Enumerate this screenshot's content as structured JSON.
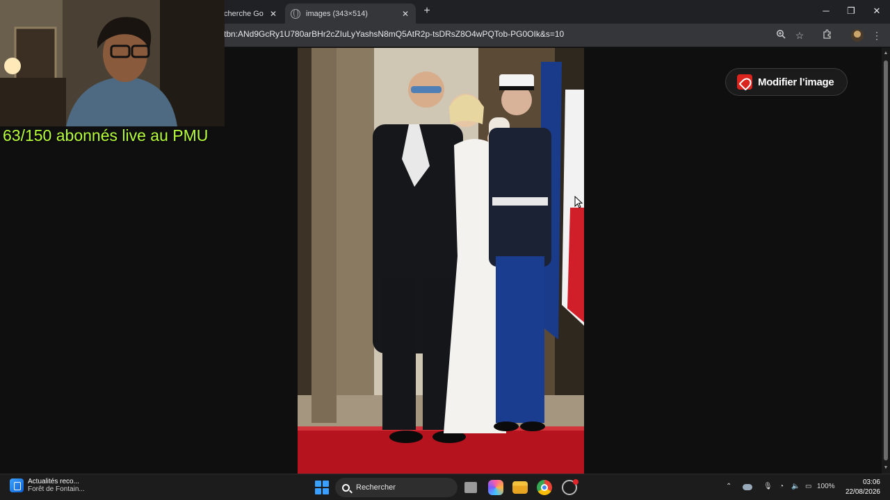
{
  "browser": {
    "tabs": [
      {
        "label": "Recherche Go",
        "active": false
      },
      {
        "label": "images (343×514)",
        "active": true
      }
    ],
    "url": "tbn:ANd9GcRy1U780arBHr2cZIuLyYashsN8mQ5AtR2p-tsDRsZ8O4wPQTob-PG0OIk&s=10",
    "window_controls": {
      "minimize": "─",
      "restore": "❐",
      "close": "✕"
    }
  },
  "viewer": {
    "modify_button_label": "Modifier l’image"
  },
  "overlay": {
    "text": "63/150 abonnés live au PMU"
  },
  "taskbar": {
    "news_title": "Actualités reco...",
    "news_subtitle": "Forêt de Fontain...",
    "search_placeholder": "Rechercher",
    "battery": "100%",
    "time": "03:06",
    "date": "22/08/2026"
  }
}
